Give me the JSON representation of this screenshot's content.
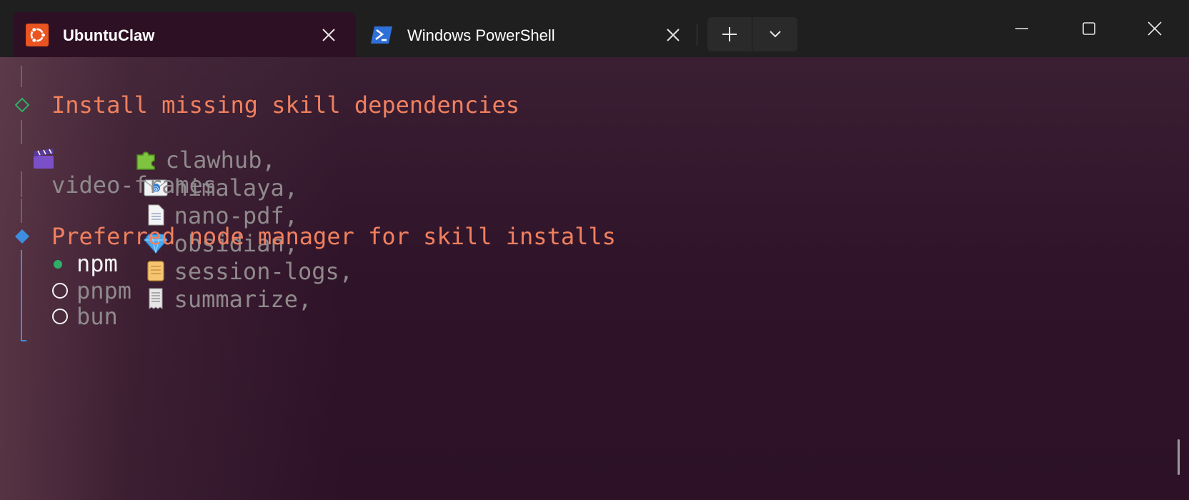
{
  "tabs": [
    {
      "title": "UbuntuClaw",
      "active": true,
      "icon": "ubuntu-icon"
    },
    {
      "title": "Windows PowerShell",
      "active": false,
      "icon": "powershell-icon"
    }
  ],
  "terminal": {
    "section1": {
      "title": "Install missing skill dependencies",
      "skills": [
        "clawhub,",
        "himalaya,",
        "nano-pdf,",
        "obsidian,",
        "session-logs,",
        "summarize,",
        "video-frames"
      ]
    },
    "section2": {
      "title": "Preferred node manager for skill installs",
      "options": [
        {
          "label": "npm",
          "selected": true
        },
        {
          "label": "pnpm",
          "selected": false
        },
        {
          "label": "bun",
          "selected": false
        }
      ]
    }
  },
  "colors": {
    "accent_orange": "#f0805e",
    "guide_blue": "#3d8ee0",
    "selected_green": "#2fae6a",
    "ubuntu_orange": "#e95420"
  }
}
